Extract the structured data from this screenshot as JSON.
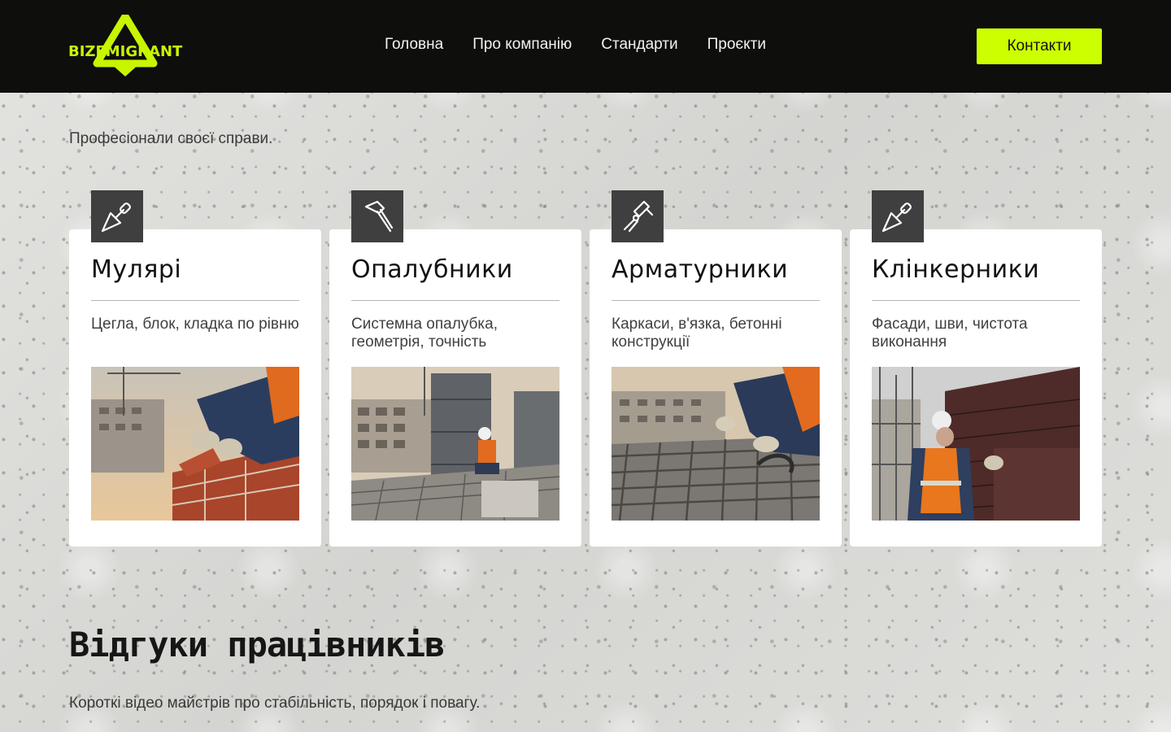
{
  "brand": {
    "logo_text": "BIZEMIGRANT",
    "accent": "#ccff00"
  },
  "nav": {
    "items": [
      {
        "label": "Головна"
      },
      {
        "label": "Про компанію"
      },
      {
        "label": "Стандарти"
      },
      {
        "label": "Проєкти"
      }
    ],
    "contact_label": "Контакти"
  },
  "specialties": {
    "subtitle": "Професіонали своєї справи.",
    "cards": [
      {
        "title": "Мулярі",
        "desc": "Цегла, блок, кладка по рівню",
        "icon": "trowel-icon"
      },
      {
        "title": "Опалубники",
        "desc": "Системна опалубка, геометрія, точність",
        "icon": "hammer-icon"
      },
      {
        "title": "Арматурники",
        "desc": "Каркаси, в'язка, бетонні конструкції",
        "icon": "pliers-icon"
      },
      {
        "title": "Клінкерники",
        "desc": "Фасади, шви, чистота виконання",
        "icon": "trowel-icon"
      }
    ]
  },
  "reviews": {
    "title": "Відгуки працівників",
    "subtitle": "Короткі відео майстрів про стабільність, порядок і повагу."
  }
}
